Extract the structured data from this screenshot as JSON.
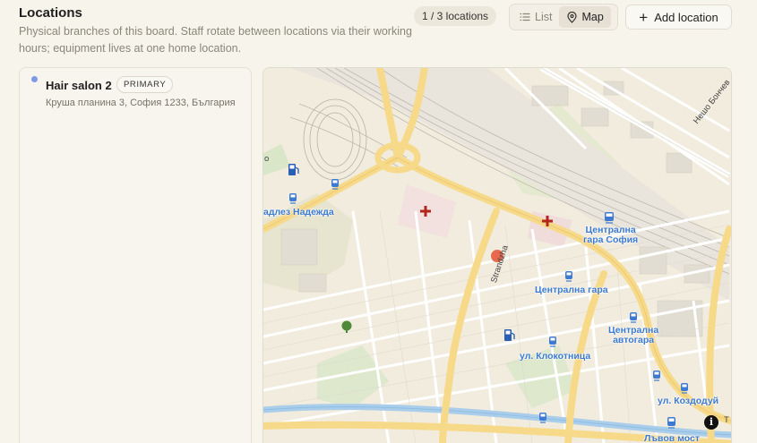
{
  "header": {
    "title": "Locations",
    "description": "Physical branches of this board. Staff rotate between locations via their working hours; equipment lives at one home location.",
    "count": "1 / 3 locations",
    "views": [
      {
        "label": "List",
        "icon": "list-icon",
        "active": false
      },
      {
        "label": "Map",
        "icon": "map-pin-icon",
        "active": true
      }
    ],
    "add_label": "Add location"
  },
  "locations": [
    {
      "name": "Hair salon 2",
      "badge": "PRIMARY",
      "address": "Круша планина 3, София 1233, България",
      "dot_color": "#7f9be8"
    }
  ],
  "map": {
    "labels": {
      "nadezhda": "адлез Надежда",
      "gara_sofia_1": "Централна",
      "gara_sofia_2": "гара София",
      "tsentralna_gara": "Централна гара",
      "avtogara_1": "Централна",
      "avtogara_2": "автогара",
      "klokotnitsa": "ул. Клокотница",
      "kozloduy": "ул. Коздодуй",
      "lavov_most": "Лъвов мост",
      "strandzha": "Strandzha",
      "nesho_bonchev": "Нешо Бончев",
      "edge_left": "о",
      "edge_right": "Т"
    },
    "marker_color": "#e8694e",
    "info_symbol": "i"
  }
}
